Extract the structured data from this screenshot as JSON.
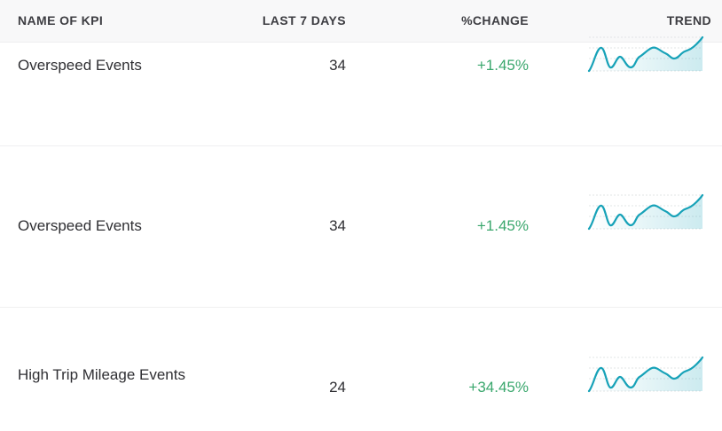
{
  "header": {
    "name": "NAME OF KPI",
    "last": "LAST 7 DAYS",
    "change": "%CHANGE",
    "trend": "TREND"
  },
  "rows": [
    {
      "name": "Overspeed Events",
      "last": "34",
      "change": "+1.45%",
      "trend_icon": "sparkline-trend-up"
    },
    {
      "name": "Overspeed Events",
      "last": "34",
      "change": "+1.45%",
      "trend_icon": "sparkline-trend-up"
    },
    {
      "name": "High Trip Mileage Events",
      "last": "24",
      "change": "+34.45%",
      "trend_icon": "sparkline-trend-up"
    }
  ],
  "colors": {
    "positive": "#3aa76d",
    "sparkline": "#17a2b8",
    "header_bg": "#f8f8f9"
  }
}
